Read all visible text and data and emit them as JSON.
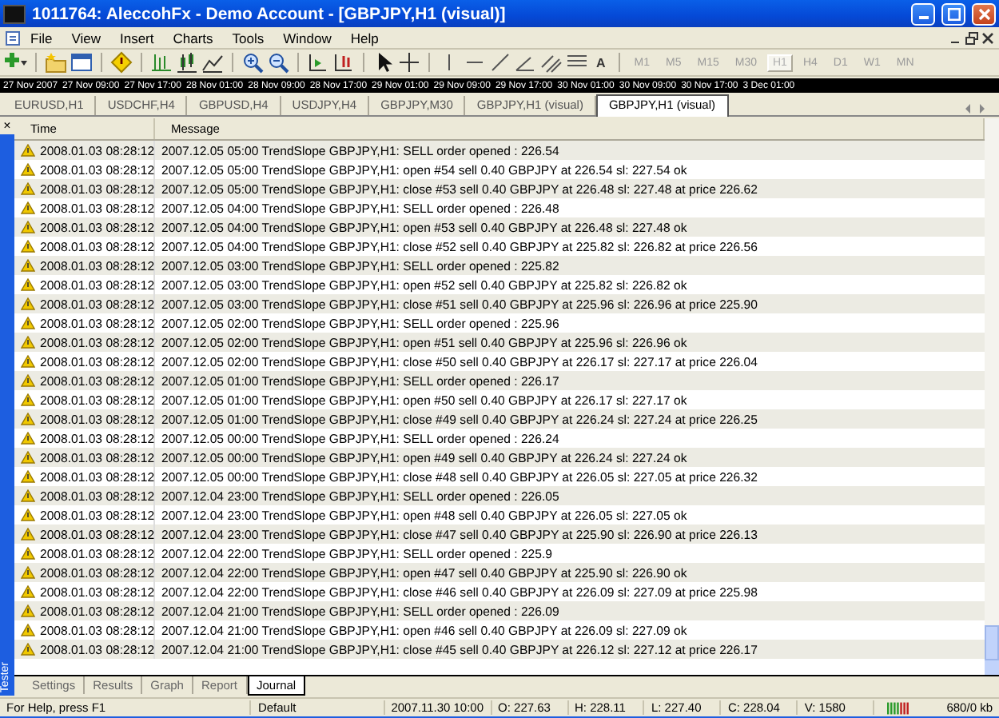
{
  "window": {
    "title": "1011764: AleccohFx - Demo Account - [GBPJPY,H1 (visual)]"
  },
  "menu": [
    "File",
    "View",
    "Insert",
    "Charts",
    "Tools",
    "Window",
    "Help"
  ],
  "toolbar": {
    "text_tool": "A",
    "timeframes": [
      {
        "label": "M1",
        "selected": false
      },
      {
        "label": "M5",
        "selected": false
      },
      {
        "label": "M15",
        "selected": false
      },
      {
        "label": "M30",
        "selected": false
      },
      {
        "label": "H1",
        "selected": true
      },
      {
        "label": "H4",
        "selected": false
      },
      {
        "label": "D1",
        "selected": false
      },
      {
        "label": "W1",
        "selected": false
      },
      {
        "label": "MN",
        "selected": false
      }
    ]
  },
  "time_scale": [
    "27 Nov 2007",
    "27 Nov 09:00",
    "27 Nov 17:00",
    "28 Nov 01:00",
    "28 Nov 09:00",
    "28 Nov 17:00",
    "29 Nov 01:00",
    "29 Nov 09:00",
    "29 Nov 17:00",
    "30 Nov 01:00",
    "30 Nov 09:00",
    "30 Nov 17:00",
    "3 Dec 01:00"
  ],
  "chart_tabs": [
    {
      "label": "EURUSD,H1",
      "selected": false
    },
    {
      "label": "USDCHF,H4",
      "selected": false
    },
    {
      "label": "GBPUSD,H4",
      "selected": false
    },
    {
      "label": "USDJPY,H4",
      "selected": false
    },
    {
      "label": "GBPJPY,M30",
      "selected": false
    },
    {
      "label": "GBPJPY,H1 (visual)",
      "selected": false
    },
    {
      "label": "GBPJPY,H1 (visual)",
      "selected": true
    }
  ],
  "tester": {
    "title": "Tester",
    "close": "×",
    "columns": [
      "Time",
      "Message"
    ],
    "rows": [
      {
        "time": "2008.01.03 08:28:12",
        "message": "2007.12.05 05:00 TrendSlope GBPJPY,H1: SELL order opened : 226.54"
      },
      {
        "time": "2008.01.03 08:28:12",
        "message": "2007.12.05 05:00 TrendSlope GBPJPY,H1: open #54 sell 0.40 GBPJPY at 226.54 sl: 227.54 ok"
      },
      {
        "time": "2008.01.03 08:28:12",
        "message": "2007.12.05 05:00 TrendSlope GBPJPY,H1: close #53 sell 0.40 GBPJPY at 226.48 sl: 227.48 at price 226.62"
      },
      {
        "time": "2008.01.03 08:28:12",
        "message": "2007.12.05 04:00 TrendSlope GBPJPY,H1: SELL order opened : 226.48"
      },
      {
        "time": "2008.01.03 08:28:12",
        "message": "2007.12.05 04:00 TrendSlope GBPJPY,H1: open #53 sell 0.40 GBPJPY at 226.48 sl: 227.48 ok"
      },
      {
        "time": "2008.01.03 08:28:12",
        "message": "2007.12.05 04:00 TrendSlope GBPJPY,H1: close #52 sell 0.40 GBPJPY at 225.82 sl: 226.82 at price 226.56"
      },
      {
        "time": "2008.01.03 08:28:12",
        "message": "2007.12.05 03:00 TrendSlope GBPJPY,H1: SELL order opened : 225.82"
      },
      {
        "time": "2008.01.03 08:28:12",
        "message": "2007.12.05 03:00 TrendSlope GBPJPY,H1: open #52 sell 0.40 GBPJPY at 225.82 sl: 226.82 ok"
      },
      {
        "time": "2008.01.03 08:28:12",
        "message": "2007.12.05 03:00 TrendSlope GBPJPY,H1: close #51 sell 0.40 GBPJPY at 225.96 sl: 226.96 at price 225.90"
      },
      {
        "time": "2008.01.03 08:28:12",
        "message": "2007.12.05 02:00 TrendSlope GBPJPY,H1: SELL order opened : 225.96"
      },
      {
        "time": "2008.01.03 08:28:12",
        "message": "2007.12.05 02:00 TrendSlope GBPJPY,H1: open #51 sell 0.40 GBPJPY at 225.96 sl: 226.96 ok"
      },
      {
        "time": "2008.01.03 08:28:12",
        "message": "2007.12.05 02:00 TrendSlope GBPJPY,H1: close #50 sell 0.40 GBPJPY at 226.17 sl: 227.17 at price 226.04"
      },
      {
        "time": "2008.01.03 08:28:12",
        "message": "2007.12.05 01:00 TrendSlope GBPJPY,H1: SELL order opened : 226.17"
      },
      {
        "time": "2008.01.03 08:28:12",
        "message": "2007.12.05 01:00 TrendSlope GBPJPY,H1: open #50 sell 0.40 GBPJPY at 226.17 sl: 227.17 ok"
      },
      {
        "time": "2008.01.03 08:28:12",
        "message": "2007.12.05 01:00 TrendSlope GBPJPY,H1: close #49 sell 0.40 GBPJPY at 226.24 sl: 227.24 at price 226.25"
      },
      {
        "time": "2008.01.03 08:28:12",
        "message": "2007.12.05 00:00 TrendSlope GBPJPY,H1: SELL order opened : 226.24"
      },
      {
        "time": "2008.01.03 08:28:12",
        "message": "2007.12.05 00:00 TrendSlope GBPJPY,H1: open #49 sell 0.40 GBPJPY at 226.24 sl: 227.24 ok"
      },
      {
        "time": "2008.01.03 08:28:12",
        "message": "2007.12.05 00:00 TrendSlope GBPJPY,H1: close #48 sell 0.40 GBPJPY at 226.05 sl: 227.05 at price 226.32"
      },
      {
        "time": "2008.01.03 08:28:12",
        "message": "2007.12.04 23:00 TrendSlope GBPJPY,H1: SELL order opened : 226.05"
      },
      {
        "time": "2008.01.03 08:28:12",
        "message": "2007.12.04 23:00 TrendSlope GBPJPY,H1: open #48 sell 0.40 GBPJPY at 226.05 sl: 227.05 ok"
      },
      {
        "time": "2008.01.03 08:28:12",
        "message": "2007.12.04 23:00 TrendSlope GBPJPY,H1: close #47 sell 0.40 GBPJPY at 225.90 sl: 226.90 at price 226.13"
      },
      {
        "time": "2008.01.03 08:28:12",
        "message": "2007.12.04 22:00 TrendSlope GBPJPY,H1: SELL order opened : 225.9"
      },
      {
        "time": "2008.01.03 08:28:12",
        "message": "2007.12.04 22:00 TrendSlope GBPJPY,H1: open #47 sell 0.40 GBPJPY at 225.90 sl: 226.90 ok"
      },
      {
        "time": "2008.01.03 08:28:12",
        "message": "2007.12.04 22:00 TrendSlope GBPJPY,H1: close #46 sell 0.40 GBPJPY at 226.09 sl: 227.09 at price 225.98"
      },
      {
        "time": "2008.01.03 08:28:12",
        "message": "2007.12.04 21:00 TrendSlope GBPJPY,H1: SELL order opened : 226.09"
      },
      {
        "time": "2008.01.03 08:28:12",
        "message": "2007.12.04 21:00 TrendSlope GBPJPY,H1: open #46 sell 0.40 GBPJPY at 226.09 sl: 227.09 ok"
      },
      {
        "time": "2008.01.03 08:28:12",
        "message": "2007.12.04 21:00 TrendSlope GBPJPY,H1: close #45 sell 0.40 GBPJPY at 226.12 sl: 227.12 at price 226.17"
      }
    ],
    "tabs": [
      {
        "label": "Settings",
        "selected": false
      },
      {
        "label": "Results",
        "selected": false
      },
      {
        "label": "Graph",
        "selected": false
      },
      {
        "label": "Report",
        "selected": false
      },
      {
        "label": "Journal",
        "selected": true
      }
    ]
  },
  "status_bar": {
    "help": "For Help, press F1",
    "profile": "Default",
    "datetime": "2007.11.30 10:00",
    "open": "O: 227.63",
    "high": "H: 228.11",
    "low": "L: 227.40",
    "close": "C: 228.04",
    "volume": "V: 1580",
    "traffic": "680/0 kb"
  }
}
